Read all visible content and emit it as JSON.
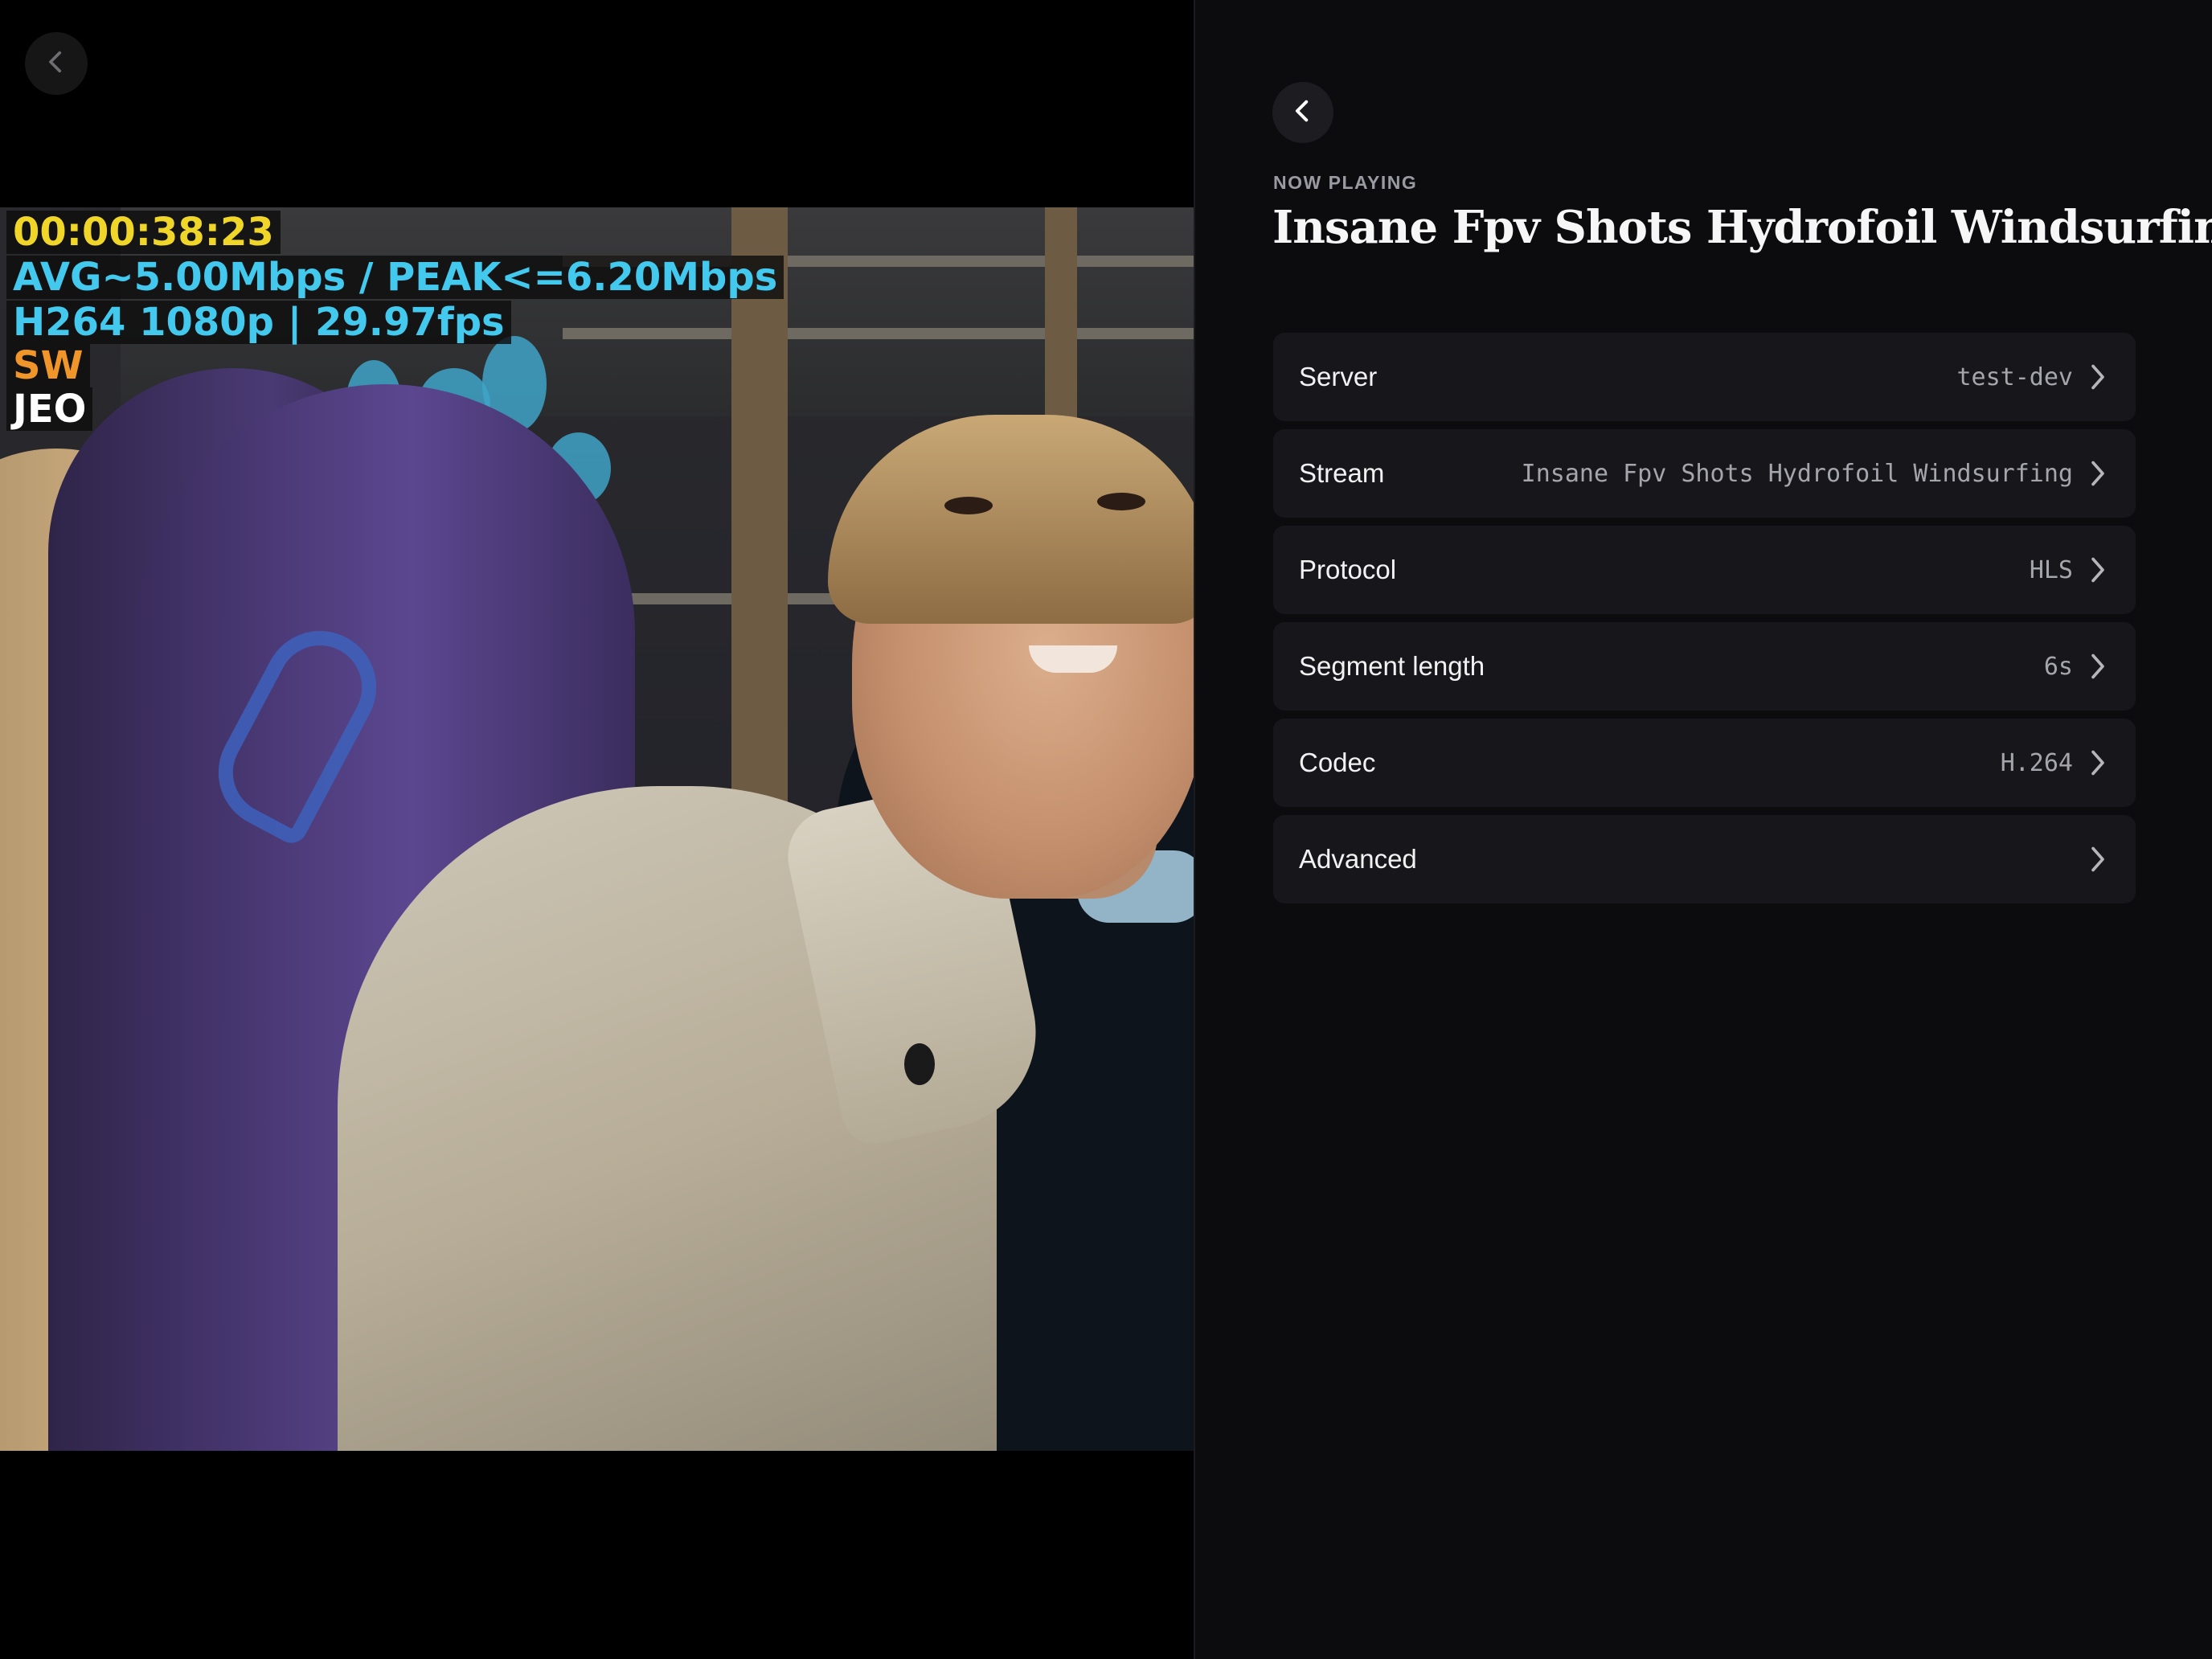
{
  "video": {
    "osd_time": "00:00:38:23",
    "osd_bitrate": "AVG~5.00Mbps / PEAK<=6.20Mbps",
    "osd_codec": "H264 1080p | 29.97fps",
    "osd_sw": "SW",
    "osd_jeo": "JEO",
    "back_icon": "chevron-left-icon"
  },
  "panel": {
    "eyebrow": "NOW PLAYING",
    "title": "Insane Fpv Shots Hydrofoil Windsurfing",
    "back_icon": "chevron-left-icon",
    "rows": [
      {
        "label": "Server",
        "value": "test-dev"
      },
      {
        "label": "Stream",
        "value": "Insane Fpv Shots Hydrofoil Windsurfing"
      },
      {
        "label": "Protocol",
        "value": "HLS"
      },
      {
        "label": "Segment length",
        "value": "6s"
      },
      {
        "label": "Codec",
        "value": "H.264"
      },
      {
        "label": "Advanced",
        "value": ""
      }
    ]
  },
  "colors": {
    "panel_bg": "#0c0c0f",
    "row_bg": "#17171b",
    "osd_yellow": "#f1d62a",
    "osd_cyan": "#43c8ee",
    "osd_orange": "#f0952a"
  }
}
